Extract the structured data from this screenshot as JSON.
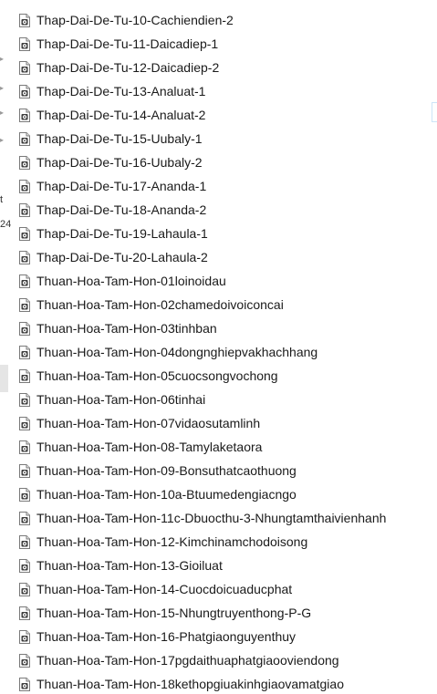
{
  "gutter": {
    "fragment_1": "t",
    "fragment_2": "24"
  },
  "files": [
    {
      "name": "Thap-Dai-De-Tu-10-Cachiendien-2",
      "icon": "audio-file-icon"
    },
    {
      "name": "Thap-Dai-De-Tu-11-Daicadiep-1",
      "icon": "audio-file-icon"
    },
    {
      "name": "Thap-Dai-De-Tu-12-Daicadiep-2",
      "icon": "audio-file-icon"
    },
    {
      "name": "Thap-Dai-De-Tu-13-Analuat-1",
      "icon": "audio-file-icon"
    },
    {
      "name": "Thap-Dai-De-Tu-14-Analuat-2",
      "icon": "audio-file-icon"
    },
    {
      "name": "Thap-Dai-De-Tu-15-Uubaly-1",
      "icon": "audio-file-icon"
    },
    {
      "name": "Thap-Dai-De-Tu-16-Uubaly-2",
      "icon": "audio-file-icon"
    },
    {
      "name": "Thap-Dai-De-Tu-17-Ananda-1",
      "icon": "audio-file-icon"
    },
    {
      "name": "Thap-Dai-De-Tu-18-Ananda-2",
      "icon": "audio-file-icon"
    },
    {
      "name": "Thap-Dai-De-Tu-19-Lahaula-1",
      "icon": "audio-file-icon"
    },
    {
      "name": "Thap-Dai-De-Tu-20-Lahaula-2",
      "icon": "audio-file-icon"
    },
    {
      "name": "Thuan-Hoa-Tam-Hon-01loinoidau",
      "icon": "audio-file-icon"
    },
    {
      "name": "Thuan-Hoa-Tam-Hon-02chamedoivoiconcai",
      "icon": "audio-file-icon"
    },
    {
      "name": "Thuan-Hoa-Tam-Hon-03tinhban",
      "icon": "audio-file-icon"
    },
    {
      "name": "Thuan-Hoa-Tam-Hon-04dongnghiepvakhachhang",
      "icon": "audio-file-icon"
    },
    {
      "name": "Thuan-Hoa-Tam-Hon-05cuocsongvochong",
      "icon": "audio-file-icon"
    },
    {
      "name": "Thuan-Hoa-Tam-Hon-06tinhai",
      "icon": "audio-file-icon"
    },
    {
      "name": "Thuan-Hoa-Tam-Hon-07vidaosutamlinh",
      "icon": "audio-file-icon"
    },
    {
      "name": "Thuan-Hoa-Tam-Hon-08-Tamylaketaora",
      "icon": "audio-file-icon"
    },
    {
      "name": "Thuan-Hoa-Tam-Hon-09-Bonsuthatcaothuong",
      "icon": "audio-file-icon"
    },
    {
      "name": "Thuan-Hoa-Tam-Hon-10a-Btuumedengiacngo",
      "icon": "audio-file-icon"
    },
    {
      "name": "Thuan-Hoa-Tam-Hon-11c-Dbuocthu-3-Nhungtamthaivienhanh",
      "icon": "audio-file-icon"
    },
    {
      "name": "Thuan-Hoa-Tam-Hon-12-Kimchinamchodoisong",
      "icon": "audio-file-icon"
    },
    {
      "name": "Thuan-Hoa-Tam-Hon-13-Gioiluat",
      "icon": "audio-file-icon"
    },
    {
      "name": "Thuan-Hoa-Tam-Hon-14-Cuocdoicuaducphat",
      "icon": "audio-file-icon"
    },
    {
      "name": "Thuan-Hoa-Tam-Hon-15-Nhungtruyenthong-P-G",
      "icon": "audio-file-icon"
    },
    {
      "name": "Thuan-Hoa-Tam-Hon-16-Phatgiaonguyenthuy",
      "icon": "audio-file-icon"
    },
    {
      "name": "Thuan-Hoa-Tam-Hon-17pgdaithuaphatgiaooviendong",
      "icon": "audio-file-icon"
    },
    {
      "name": "Thuan-Hoa-Tam-Hon-18kethopgiuakinhgiaovamatgiao",
      "icon": "audio-file-icon"
    }
  ]
}
